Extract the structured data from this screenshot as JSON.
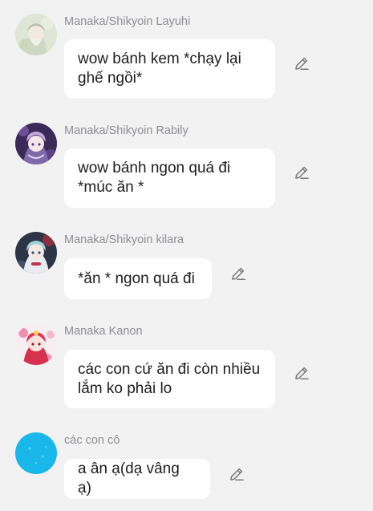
{
  "messages": [
    {
      "name": "Manaka/Shikyoin Layuhi",
      "text": "wow bánh kem *chạy lại ghế ngồi*",
      "avatar_icon": "character-avatar-icon",
      "edit_icon": "pencil-icon"
    },
    {
      "name": "Manaka/Shikyoin Rabily",
      "text": "wow bánh ngon quá đi *múc ăn *",
      "avatar_icon": "character-avatar-icon",
      "edit_icon": "pencil-icon"
    },
    {
      "name": "Manaka/Shikyoin kilara",
      "text": "*ăn * ngon quá đi",
      "avatar_icon": "character-avatar-icon",
      "edit_icon": "pencil-icon"
    },
    {
      "name": "Manaka Kanon",
      "text": "các con cứ ăn đi còn nhiều lắm ko phải lo",
      "avatar_icon": "character-avatar-icon",
      "edit_icon": "pencil-icon"
    },
    {
      "name": "các con cô",
      "text": "a ân ạ(dạ vâng ạ)",
      "avatar_icon": "blue-avatar-icon",
      "edit_icon": "pencil-icon"
    }
  ],
  "colors": {
    "background": "#f2f2f3",
    "bubble": "#ffffff",
    "name_text": "#8e8e93",
    "message_text": "#1c1c1e",
    "edit_icon": "#7a7a7e"
  }
}
